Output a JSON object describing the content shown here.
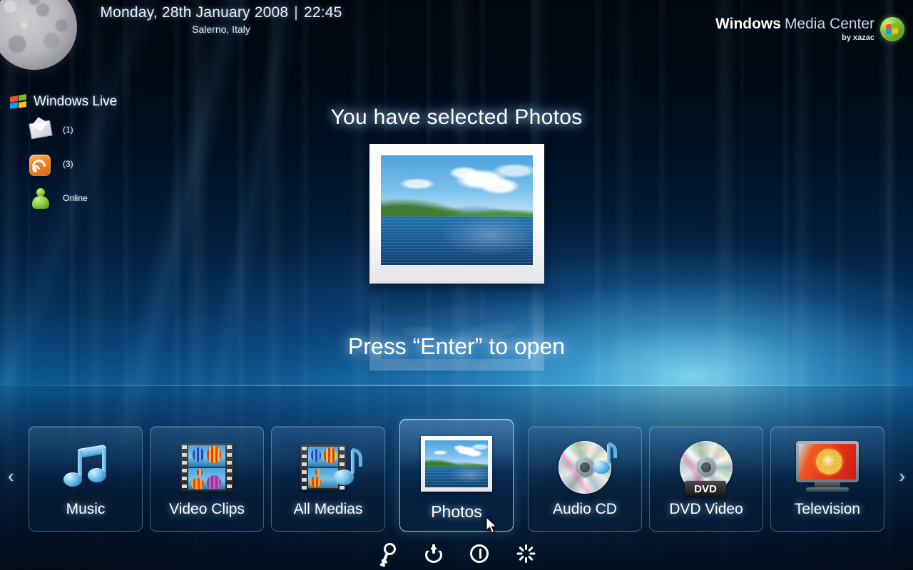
{
  "header": {
    "moon_icon": "moon-icon",
    "date": "Monday, 28th January 2008",
    "separator": "|",
    "time": "22:45",
    "location": "Salerno, Italy",
    "brand_primary": "Windows",
    "brand_secondary": "Media Center",
    "brand_author": "by xazac",
    "brand_orb_icon": "windows-orb-icon"
  },
  "windows_live": {
    "title": "Windows Live",
    "logo_icon": "windows-flag-icon",
    "items": [
      {
        "icon": "mail-envelope-icon",
        "value": "(1)"
      },
      {
        "icon": "rss-feed-icon",
        "value": "(3)"
      },
      {
        "icon": "messenger-person-icon",
        "value": "Online"
      }
    ]
  },
  "main": {
    "title": "You have selected Photos",
    "subtitle": "Press “Enter” to open",
    "preview_icon": "photo-landscape-preview"
  },
  "strip": {
    "prev_arrow": "‹",
    "next_arrow": "›",
    "tiles": [
      {
        "label": "Music",
        "icon": "music-note-icon",
        "selected": false
      },
      {
        "label": "Video Clips",
        "icon": "film-strip-icon",
        "selected": false
      },
      {
        "label": "All Medias",
        "icon": "film-and-note-icon",
        "selected": false
      },
      {
        "label": "Photos",
        "icon": "photo-frame-icon",
        "selected": true
      },
      {
        "label": "Audio CD",
        "icon": "cd-music-icon",
        "selected": false
      },
      {
        "label": "DVD Video",
        "icon": "dvd-disc-icon",
        "selected": false,
        "badge": "DVD"
      },
      {
        "label": "Television",
        "icon": "television-icon",
        "selected": false
      }
    ]
  },
  "controls": [
    {
      "name": "lock-key-icon"
    },
    {
      "name": "power-icon"
    },
    {
      "name": "standby-icon"
    },
    {
      "name": "restart-spinner-icon"
    }
  ],
  "colors": {
    "accent_cyan": "#5ec4ef",
    "background_deep": "#000610",
    "background_mid": "#0a4f84",
    "text_primary": "#ffffff",
    "rss_orange": "#f58220",
    "presence_green": "#7cc12e"
  }
}
